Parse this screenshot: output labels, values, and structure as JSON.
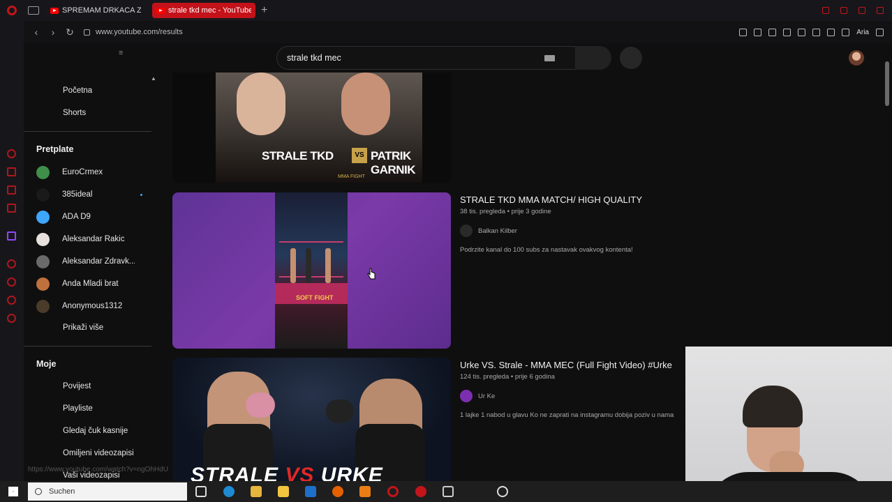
{
  "browser": {
    "tabs": [
      {
        "label": "SPREMAM DRKACA ZA B..."
      },
      {
        "label": "strale tkd mec - YouTube"
      }
    ],
    "address": "www.youtube.com/results",
    "ai_label": "Aria"
  },
  "youtube": {
    "search": {
      "query": "strale tkd mec"
    },
    "sidebar": {
      "nav": [
        {
          "label": "Početna"
        },
        {
          "label": "Shorts"
        }
      ],
      "subscriptions_heading": "Pretplate",
      "subscriptions": [
        {
          "name": "EuroCrmex",
          "color": "#3f8f4a"
        },
        {
          "name": "385ideal",
          "color": "#1a1a1a",
          "new": true
        },
        {
          "name": "ADA D9",
          "color": "#3ea6ff"
        },
        {
          "name": "Aleksandar Rakic",
          "color": "#e8e0dc"
        },
        {
          "name": "Aleksandar Zdravk...",
          "color": "#6a6a6a"
        },
        {
          "name": "Anda Mladi brat",
          "color": "#c0703d"
        },
        {
          "name": "Anonymous1312",
          "color": "#4a3b2a"
        }
      ],
      "show_more": "Prikaži više",
      "you_heading": "Moje",
      "you_items": [
        {
          "label": "Povijest"
        },
        {
          "label": "Playliste"
        },
        {
          "label": "Gledaj čuk kasnije"
        },
        {
          "label": "Omiljeni videozapisi"
        },
        {
          "label": "Vaši videozapisi"
        }
      ],
      "status_url": "https://www.youtube.com/watch?v=ngOhHdU"
    },
    "results": [
      {
        "thumbnail_text": "STRALE TKD",
        "thumbnail_text_right": "PATRIK GARNIK",
        "thumbnail_vs": "VS",
        "thumbnail_sub": "MMA FIGHT"
      },
      {
        "title": "STRALE TKD MMA MATCH/ HIGH QUALITY",
        "meta": "38 tis. pregleda • prije 3 godine",
        "channel": "Balkan Kilber",
        "description": "Podrzite kanal do 100 subs za nastavak ovakvog kontenta!",
        "thumbnail_text": "SOFT FIGHT"
      },
      {
        "title": "Urke VS. Strale - MMA MEC (Full Fight Video) #Urke",
        "meta": "124 tis. pregleda • prije 6 godina",
        "channel": "Ur Ke",
        "description": "1 lajke 1 nabod u glavu Ko ne zaprati na instagramu dobija poziv u nama",
        "thumbnail_text_left": "STRALE",
        "thumbnail_vs": "VS",
        "thumbnail_text_right": "URKE"
      }
    ]
  },
  "taskbar": {
    "search_placeholder": "Suchen"
  },
  "colors": {
    "opera_red": "#c3121a",
    "background": "#0f0f0f",
    "accent_blue": "#3ea6ff"
  }
}
